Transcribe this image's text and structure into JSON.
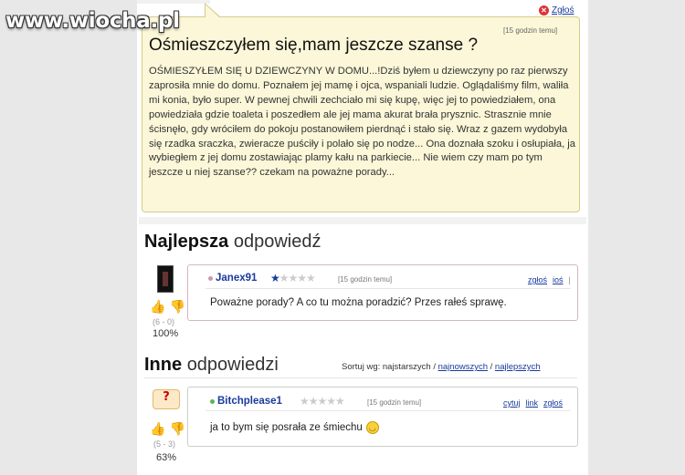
{
  "watermark": "www.wiocha.pl",
  "question": {
    "report_label": "Zgłoś",
    "time": "[15 godzin temu]",
    "title": "Ośmieszczyłem się,mam jeszcze szanse ?",
    "body": "OŚMIESZYŁEM SIĘ U DZIEWCZYNY W DOMU...!Dziś byłem u dziewczyny po raz pierwszy zaprosiła mnie do domu. Poznałem jej mamę i ojca, wspaniali ludzie. Oglądaliśmy film, waliła mi konia, było super. W pewnej chwili zechciało mi się kupę, więc jej to powiedziałem, ona powiedziała gdzie toaleta i poszedłem ale jej mama akurat brała prysznic. Strasznie mnie ścisnęło, gdy wróciłem do pokoju postanowiłem pierdnąć i stało się. Wraz z gazem wydobyła się rzadka sraczka, zwieracze puściły i polało się po nodze... Ona doznała szoku i osłupiała, ja wybiegłem z jej domu zostawiając plamy kału na parkiecie... Nie wiem czy mam po tym jeszcze u niej szanse?? czekam na poważne porady..."
  },
  "best": {
    "heading_bold": "Najlepsza",
    "heading_rest": "odpowiedź",
    "user": "Janex91",
    "rating": 1,
    "time": "[15 godzin temu]",
    "links": [
      "zgłoś",
      "ioś",
      "|"
    ],
    "text": "Poważne porady? A co tu można poradzić? Przes rałeś sprawę.",
    "votes": "(6 - 0)",
    "percent": "100%"
  },
  "others": {
    "heading_bold": "Inne",
    "heading_rest": "odpowiedzi",
    "sort_prefix": "Sortuj wg: najstarszych /",
    "sort_newest": "najnowszych",
    "sort_sep": "/",
    "sort_best": "najlepszych",
    "answer": {
      "user": "Bitchplease1",
      "rating": 0,
      "time": "[15 godzin temu]",
      "links": [
        "cytuj",
        "link",
        "zgłoś"
      ],
      "text": "ja to bym się posrała ze śmiechu",
      "votes": "(5 - 3)",
      "percent": "63%"
    }
  },
  "colors": {
    "question_bg": "#fbf7d8",
    "link": "#1a3a9c"
  }
}
